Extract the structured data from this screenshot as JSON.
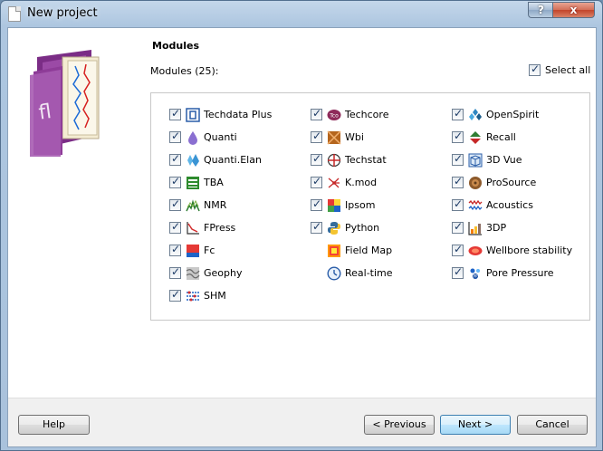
{
  "window": {
    "title": "New project",
    "help_glyph": "?",
    "close_glyph": "x"
  },
  "section_title": "Modules",
  "modules_count": "Modules (25):",
  "select_all": {
    "label": "Select all",
    "checked": true
  },
  "columns": [
    [
      {
        "label": "Techdata Plus",
        "checked": true,
        "icon": "techdata-icon"
      },
      {
        "label": "Quanti",
        "checked": true,
        "icon": "drop-icon"
      },
      {
        "label": "Quanti.Elan",
        "checked": true,
        "icon": "crystal-icon"
      },
      {
        "label": "TBA",
        "checked": true,
        "icon": "tba-icon"
      },
      {
        "label": "NMR",
        "checked": true,
        "icon": "nmr-icon"
      },
      {
        "label": "FPress",
        "checked": true,
        "icon": "fpress-icon"
      },
      {
        "label": "Fc",
        "checked": true,
        "icon": "fc-icon"
      },
      {
        "label": "Geophy",
        "checked": true,
        "icon": "geophy-icon"
      },
      {
        "label": "SHM",
        "checked": true,
        "icon": "shm-icon"
      }
    ],
    [
      {
        "label": "Techcore",
        "checked": true,
        "icon": "techcore-icon"
      },
      {
        "label": "Wbi",
        "checked": true,
        "icon": "wbi-icon"
      },
      {
        "label": "Techstat",
        "checked": true,
        "icon": "techstat-icon"
      },
      {
        "label": "K.mod",
        "checked": true,
        "icon": "kmod-icon"
      },
      {
        "label": "Ipsom",
        "checked": true,
        "icon": "ipsom-icon"
      },
      {
        "label": "Python",
        "checked": true,
        "icon": "python-icon"
      },
      {
        "label": "Field Map",
        "checked": false,
        "icon": "fieldmap-icon"
      },
      {
        "label": "Real-time",
        "checked": false,
        "icon": "clock-icon"
      }
    ],
    [
      {
        "label": "OpenSpirit",
        "checked": true,
        "icon": "openspirit-icon"
      },
      {
        "label": "Recall",
        "checked": true,
        "icon": "recall-icon"
      },
      {
        "label": "3D Vue",
        "checked": true,
        "icon": "cube-icon"
      },
      {
        "label": "ProSource",
        "checked": true,
        "icon": "prosource-icon"
      },
      {
        "label": "Acoustics",
        "checked": true,
        "icon": "acoustics-icon"
      },
      {
        "label": "3DP",
        "checked": true,
        "icon": "3dp-icon"
      },
      {
        "label": "Wellbore stability",
        "checked": true,
        "icon": "wellbore-icon"
      },
      {
        "label": "Pore Pressure",
        "checked": true,
        "icon": "pore-pressure-icon"
      }
    ]
  ],
  "buttons": {
    "help": "Help",
    "previous": "< Previous",
    "next": "Next >",
    "cancel": "Cancel"
  }
}
